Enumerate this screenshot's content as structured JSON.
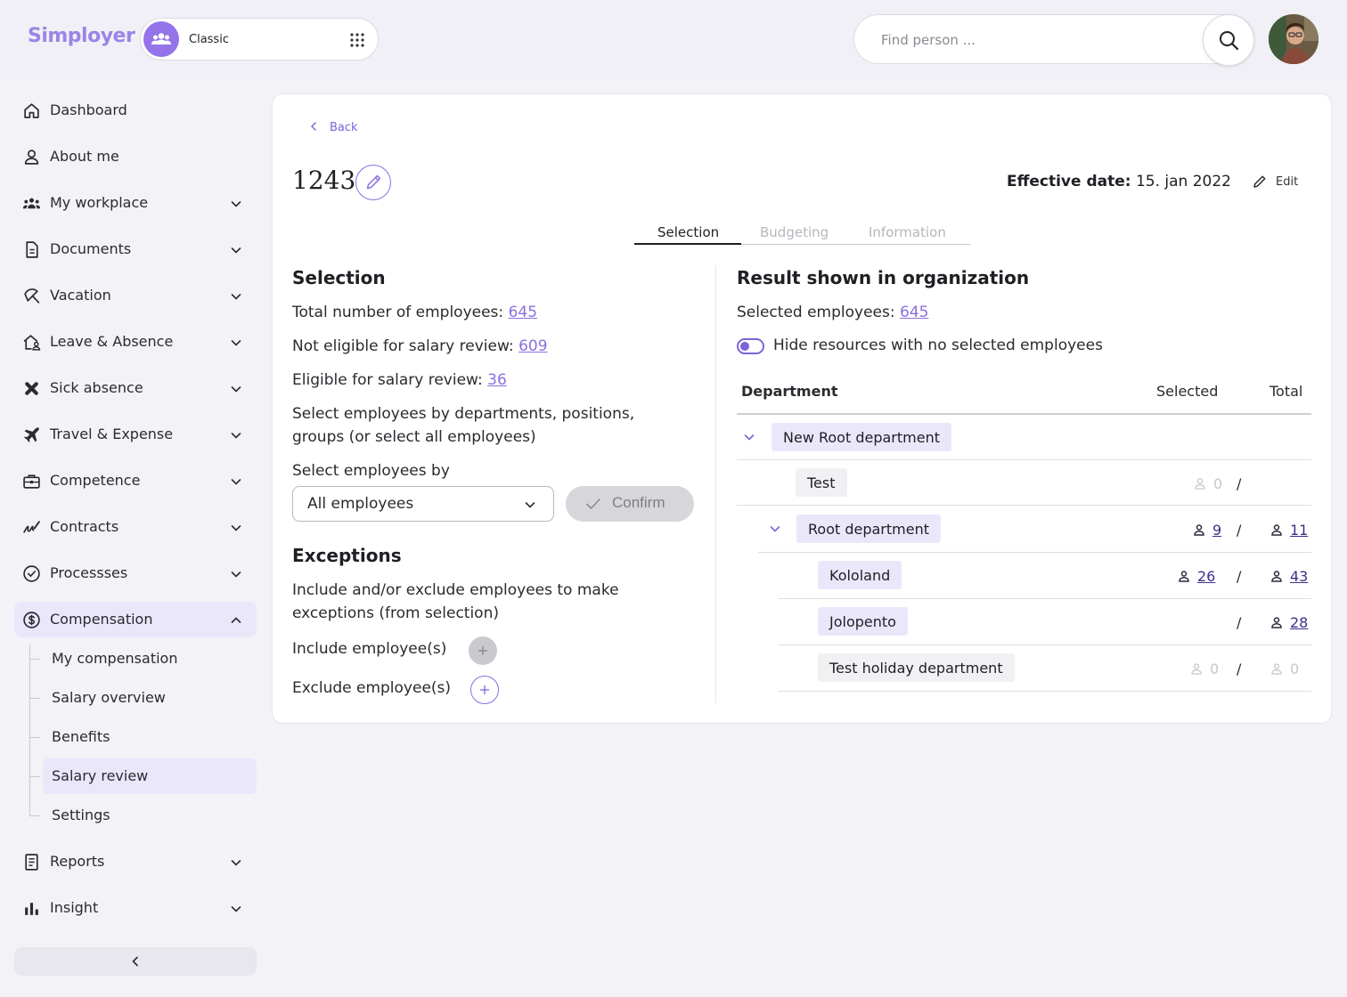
{
  "app": {
    "brand": "Simployer",
    "workspace": "Classic"
  },
  "search": {
    "placeholder": "Find person ..."
  },
  "sidebar": {
    "items": [
      {
        "label": "Dashboard",
        "icon": "home-icon"
      },
      {
        "label": "About me",
        "icon": "person-icon"
      },
      {
        "label": "My workplace",
        "icon": "group-icon"
      },
      {
        "label": "Documents",
        "icon": "document-icon"
      },
      {
        "label": "Vacation",
        "icon": "umbrella-icon"
      },
      {
        "label": "Leave & Absence",
        "icon": "house-person-icon"
      },
      {
        "label": "Sick absence",
        "icon": "bandage-icon"
      },
      {
        "label": "Travel & Expense",
        "icon": "airplane-icon"
      },
      {
        "label": "Competence",
        "icon": "briefcase-icon"
      },
      {
        "label": "Contracts",
        "icon": "signature-icon"
      },
      {
        "label": "Processses",
        "icon": "check-circle-icon"
      },
      {
        "label": "Compensation",
        "icon": "dollar-circle-icon"
      },
      {
        "label": "Reports",
        "icon": "report-icon"
      },
      {
        "label": "Insight",
        "icon": "bar-chart-icon"
      }
    ],
    "compensation_sub": [
      "My compensation",
      "Salary overview",
      "Benefits",
      "Salary review",
      "Settings"
    ]
  },
  "page": {
    "back": "Back",
    "title": "1243",
    "effective_label": "Effective date:",
    "effective_value": "15. jan 2022",
    "edit": "Edit",
    "tabs": [
      "Selection",
      "Budgeting",
      "Information"
    ]
  },
  "selection": {
    "heading": "Selection",
    "total_label": "Total number of employees:",
    "total_value": "645",
    "not_eligible_label": "Not eligible for salary review:",
    "not_eligible_value": "609",
    "eligible_label": "Eligible for salary review:",
    "eligible_value": "36",
    "desc_line1": "Select employees by departments, positions,",
    "desc_line2": "groups (or select all employees)",
    "select_by_label": "Select employees by",
    "select_value": "All employees",
    "confirm": "Confirm"
  },
  "exceptions": {
    "heading": "Exceptions",
    "desc_line1": "Include and/or exclude employees to make",
    "desc_line2": "exceptions (from selection)",
    "include": "Include employee(s)",
    "exclude": "Exclude employee(s)"
  },
  "result": {
    "heading": "Result shown in organization",
    "selected_label": "Selected employees:",
    "selected_value": "645",
    "toggle_label": "Hide resources with no selected employees",
    "col_department": "Department",
    "col_selected": "Selected",
    "col_total": "Total",
    "rows": [
      {
        "name": "New Root department",
        "selected": "",
        "total": ""
      },
      {
        "name": "Test",
        "selected": "0",
        "total": ""
      },
      {
        "name": "Root department",
        "selected": "9",
        "total": "11"
      },
      {
        "name": "Kololand",
        "selected": "26",
        "total": "43"
      },
      {
        "name": "Jolopento",
        "selected": "",
        "total": "28"
      },
      {
        "name": "Test holiday department",
        "selected": "0",
        "total": "0"
      }
    ],
    "slash": "/"
  },
  "colors": {
    "brand": "#9b85e6",
    "accent": "#7b63d8",
    "highlight": "#ebe7fb",
    "muted": "#c7c6cd"
  }
}
